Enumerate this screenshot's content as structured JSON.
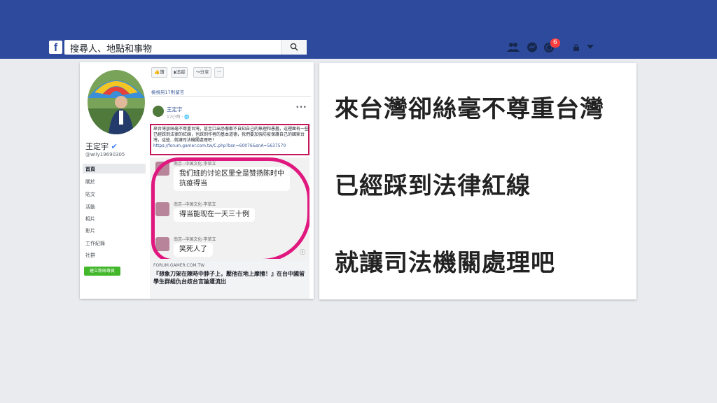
{
  "topbar": {
    "logo": "f",
    "search_placeholder": "搜尋人、地點和事物",
    "notification_count": "6"
  },
  "profile": {
    "name": "王定宇",
    "handle": "@wily19690305",
    "menu": [
      "首頁",
      "關於",
      "貼文",
      "活動",
      "相片",
      "影片",
      "工作紀錄",
      "社群"
    ],
    "create_page_btn": "建立粉絲專頁"
  },
  "feed": {
    "toolbar": [
      "讚",
      "追蹤",
      "分享",
      "···"
    ],
    "more_comments": "檢視另17則留言",
    "post": {
      "author": "王定宇",
      "time": "17小時",
      "text": "來台灣卻絲毫不尊重台灣，甚至口出恐嚇都不自知自己的無理和愚蠢，這裡面有一些已經踩到法律的紅線，也踩到作者的基本道德，我們要加強防疫保護自己的國家台灣，這些...就讓司法機關處理吧！",
      "link_url": "https://forum.gamer.com.tw/C.php?bsn=60076&snA=5637570"
    },
    "comments": [
      {
        "name": "南京--中国文化-李草立",
        "text": "我们班的讨论区里全是赞扬陈时中抗疫得当"
      },
      {
        "name": "南京--中国文化-李草立",
        "text": "得当能现在一天三十例"
      },
      {
        "name": "南京--中国文化-李草立",
        "text": "笑死人了"
      }
    ],
    "link_preview": {
      "domain": "FORUM.GAMER.COM.TW",
      "title": "『想象刀架在陳時中脖子上，壓他在地上摩擦！』在台中國留學生群組仇台歧台言論遭流出"
    }
  },
  "captions": [
    "來台灣卻絲毫不尊重台灣",
    "已經踩到法律紅線",
    "就讓司法機關處理吧"
  ]
}
